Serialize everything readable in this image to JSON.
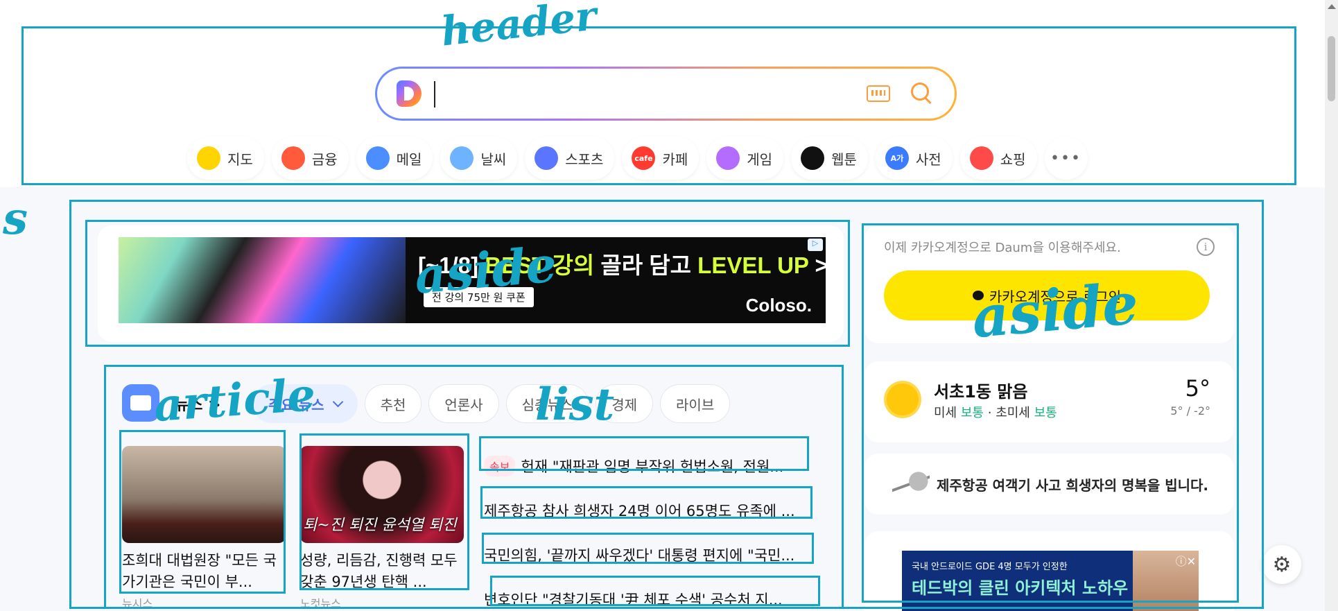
{
  "search": {
    "placeholder": ""
  },
  "services": [
    {
      "label": "지도",
      "icon": "map-pin-icon",
      "color": "#ffd400"
    },
    {
      "label": "금융",
      "icon": "finance-chart-icon",
      "color": "#ff5a3c"
    },
    {
      "label": "메일",
      "icon": "mail-icon",
      "color": "#4c8dff"
    },
    {
      "label": "날씨",
      "icon": "weather-icon",
      "color": "#6db3ff"
    },
    {
      "label": "스포츠",
      "icon": "sports-icon",
      "color": "#5a75ff"
    },
    {
      "label": "카페",
      "icon": "cafe-icon",
      "color": "#ff3b30",
      "glyph": "cafe"
    },
    {
      "label": "게임",
      "icon": "game-icon",
      "color": "#b46cff"
    },
    {
      "label": "웹툰",
      "icon": "webtoon-icon",
      "color": "#111111"
    },
    {
      "label": "사전",
      "icon": "dictionary-icon",
      "color": "#3a7bff",
      "glyph": "A가"
    },
    {
      "label": "쇼핑",
      "icon": "shopping-bag-icon",
      "color": "#ff4a4a"
    }
  ],
  "more_label": "•••",
  "ad": {
    "headline_prefix": "[~1/8] ",
    "headline_highlight": "BEST 강의",
    "headline_mid": " 골라 담고 ",
    "headline_highlight2": "LEVEL UP",
    "headline_suffix": " >",
    "sub": "전 강의 75만 원 쿠폰",
    "brand": "Coloso.",
    "badge": "▷"
  },
  "news": {
    "title": "뉴스 >",
    "tabs": [
      {
        "label": "주요 뉴스",
        "active": true
      },
      {
        "label": "추천",
        "active": false
      },
      {
        "label": "언론사",
        "active": false
      },
      {
        "label": "심층뉴스",
        "active": false
      },
      {
        "label": "경제",
        "active": false
      },
      {
        "label": "라이브",
        "active": false
      }
    ],
    "cards": [
      {
        "title": "조희대 대법원장 \"모든 국가기관은 국민이 부...",
        "source": "뉴시스",
        "caption": ""
      },
      {
        "title": "성량, 리듬감, 진행력 모두 갖춘 97년생 탄핵 ...",
        "source": "노컷뉴스",
        "caption": "퇴~진 퇴진 윤석열 퇴진"
      }
    ],
    "headlines": [
      {
        "badge": "속보",
        "text": "헌재 \"재판관 임명 부작위 헌법소원, 전원..."
      },
      {
        "badge": "",
        "text": "제주항공 참사 희생자 24명 이어 65명도 유족에 ..."
      },
      {
        "badge": "",
        "text": "국민의힘, '끝까지 싸우겠다' 대통령 편지에 \"국민..."
      },
      {
        "badge": "",
        "text": "변호인단 \"경찰기동대 '尹 체포 수색' 공수처 지..."
      }
    ]
  },
  "aside": {
    "login_notice": "이제 카카오계정으로 Daum을 이용해주세요.",
    "info": "i",
    "login_button": "카카오계정으로 로그인",
    "weather": {
      "location": "서초1동 맑음",
      "dust_label": "미세",
      "dust_value": "보통",
      "sep": "·",
      "ultra_label": "초미세",
      "ultra_value": "보통",
      "temp": "5°",
      "range": "5° / -2°"
    },
    "memorial": "제주항공 여객기 사고 희생자의 명복을 빕니다.",
    "ad2": {
      "top": "국내 안드로이드 GDE 4명 모두가 인정한",
      "main": "테드박의 클린 아키텍처 노하우",
      "close": "ⓘ✕"
    }
  },
  "annotations": {
    "header": "header",
    "section": "s",
    "aside_ad": "aside",
    "aside_right": "aside",
    "article": "article",
    "list": "list"
  },
  "colors": {
    "annotation": "#15a4c4",
    "kakao_yellow": "#fee500",
    "accent": "#4a6fe0"
  }
}
